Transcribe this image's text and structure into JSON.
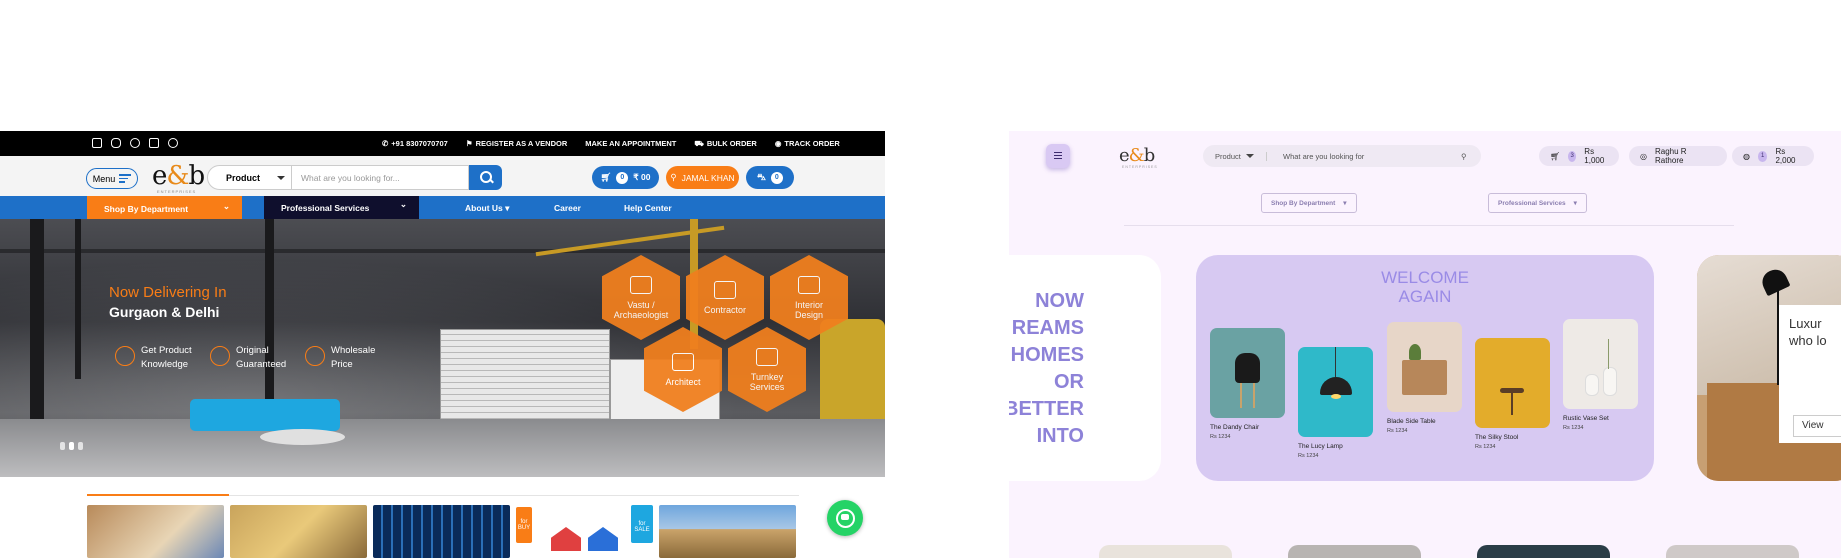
{
  "left_site": {
    "topbar": {
      "social_icons": [
        "facebook-icon",
        "instagram-icon",
        "twitter-icon",
        "linkedin-icon",
        "skype-icon"
      ],
      "phone": "+91 8307070707",
      "register": "REGISTER AS A VENDOR",
      "appointment": "MAKE AN APPOINTMENT",
      "bulk": "BULK ORDER",
      "track": "TRACK ORDER"
    },
    "header": {
      "menu_label": "Menu",
      "logo": "e&b",
      "logo_tagline": "ENTERPRISES",
      "category": "Product",
      "search_placeholder": "What are you looking for...",
      "cart_count": "0",
      "cart_amount": "₹ 00",
      "user_name": "JAMAL KHAN",
      "basket_count": "0"
    },
    "nav": {
      "shop": "Shop By Department",
      "professional": "Professional Services",
      "about": "About Us",
      "career": "Career",
      "help": "Help Center"
    },
    "hero": {
      "title": "Now Delivering In",
      "subtitle": "Gurgaon & Delhi",
      "features": [
        {
          "line1": "Get Product",
          "line2": "Knowledge"
        },
        {
          "line1": "Original",
          "line2": "Guaranteed"
        },
        {
          "line1": "Wholesale",
          "line2": "Price"
        }
      ],
      "services": [
        {
          "line1": "Vastu /",
          "line2": "Archaeologist"
        },
        {
          "line1": "Contractor",
          "line2": ""
        },
        {
          "line1": "Interior",
          "line2": "Design"
        },
        {
          "line1": "Architect",
          "line2": ""
        },
        {
          "line1": "Turnkey",
          "line2": "Services"
        }
      ]
    },
    "thumb_labels": [
      "for BUY",
      "for SALE"
    ],
    "colors": {
      "accent_orange": "#f97d16",
      "primary_blue": "#1e70c8",
      "dark_navy": "#0f0f2d",
      "whatsapp_green": "#25d366"
    }
  },
  "right_site": {
    "logo": "e&b",
    "logo_tagline": "ENTERPRISES",
    "search_category": "Product",
    "search_placeholder": "What are you looking for",
    "cart": {
      "count": "3",
      "amount": "Rs 1,000"
    },
    "user": "Raghu R Rathore",
    "wallet": {
      "count": "1",
      "amount": "Rs 2,000"
    },
    "dropdowns": {
      "shop": "Shop By Department",
      "professional": "Professional Services"
    },
    "left_card_text": [
      "NOW",
      "REAMS",
      "HOMES",
      "OR",
      "BETTER",
      "INTO"
    ],
    "welcome": [
      "WELCOME",
      "AGAIN"
    ],
    "products": [
      {
        "name": "The Dandy Chair",
        "price": "Rs 1234"
      },
      {
        "name": "The Lucy Lamp",
        "price": "Rs 1234"
      },
      {
        "name": "Blade Side Table",
        "price": "Rs 1234"
      },
      {
        "name": "The Silky Stool",
        "price": "Rs 1234"
      },
      {
        "name": "Rustic Vase Set",
        "price": "Rs 1234"
      }
    ],
    "right_card": {
      "line1": "Luxur",
      "line2": "who lo",
      "button": "View"
    },
    "colors": {
      "bg": "#fbf3fe",
      "lavender": "#d7c9f2",
      "heading": "#9a8be6"
    }
  }
}
